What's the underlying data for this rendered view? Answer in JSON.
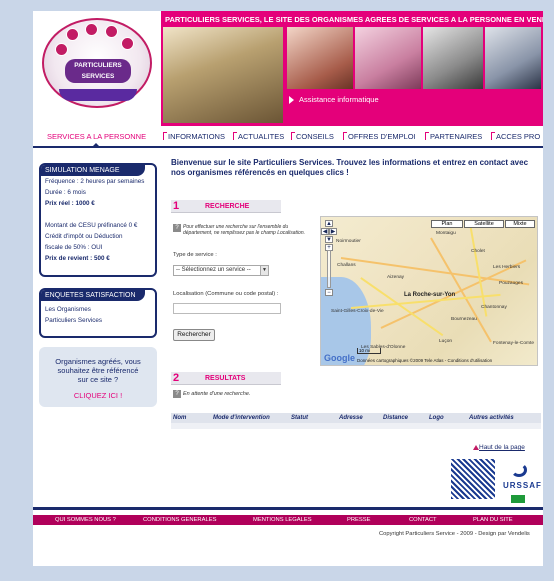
{
  "header": {
    "logo_text_line1": "PARTICULIERS",
    "logo_text_line2": "SERVICES",
    "slogan": "PARTICULIERS SERVICES, LE SITE DES ORGANISMES AGREES DE SERVICES A LA PERSONNE EN VENDEE",
    "banner_caption": "Assistance informatique"
  },
  "nav": {
    "items": [
      "SERVICES A LA PERSONNE",
      "INFORMATIONS",
      "ACTUALITES",
      "CONSEILS",
      "OFFRES D'EMPLOI",
      "PARTENAIRES",
      "ACCES PRO"
    ],
    "active_index": 0
  },
  "sidebar": {
    "simulation": {
      "title": "SIMULATION MENAGE",
      "lines": [
        "Fréquence : 2 heures par semaines",
        "Durée : 6 mois",
        "Prix réel : 1000 €",
        "",
        "Montant de CESU préfinancé 0 €",
        "Crédit d'impôt ou Déduction",
        "fiscale de 50% : OUI",
        "Prix de revient : 500 €"
      ]
    },
    "enquetes": {
      "title": "ENQUETES SATISFACTION",
      "items": [
        "Les Organismes",
        "Particuliers Services"
      ]
    },
    "promo": {
      "text_line1": "Organismes agréés, vous",
      "text_line2": "souhaitez être référencé",
      "text_line3": "sur ce site ?",
      "link": "CLIQUEZ ICI !"
    }
  },
  "main": {
    "welcome": "Bienvenue sur le site Particuliers Services. Trouvez les informations et entrez en contact avec nos organismes référencés en quelques clics !",
    "search": {
      "number": "1",
      "title": "RECHERCHE",
      "help_line1": "Pour effectuer une recherche sur l'ensemble du",
      "help_line2": "département, ne remplissez pas le champ Localisation.",
      "service_label": "Type de service :",
      "service_value": "-- Sélectionnez un service --",
      "location_label": "Localisation (Commune ou code postal) :",
      "location_value": "",
      "button": "Rechercher"
    },
    "results": {
      "number": "2",
      "title": "RESULTATS",
      "waiting": "En attente d'une recherche.",
      "columns": [
        "Nom",
        "Mode d'intervention",
        "Statut",
        "Adresse",
        "Distance",
        "Logo",
        "Autres activités"
      ]
    },
    "map": {
      "buttons": [
        "Plan",
        "Satellite",
        "Mixte"
      ],
      "cities": [
        "Cholet",
        "Les Herbiers",
        "Chantonnay",
        "La Roche-sur-Yon",
        "Aizenay",
        "Challans",
        "Saint-Gilles-Croix-de-Vie",
        "Les Sables-d'Olonne",
        "Luçon",
        "Fontenay-le-Comte",
        "Montaigu",
        "Noirmoutier",
        "Pouzauges",
        "Bournezeau"
      ],
      "copyright": "Données cartographiques ©2009 Tele Atlas - Conditions d'utilisation",
      "brand": "Google",
      "scale": "10 mi"
    }
  },
  "top_link": "Haut de la page",
  "partner": {
    "name": "URSSAF"
  },
  "footer": {
    "items": [
      "QUI SOMMES NOUS ?",
      "CONDITIONS GENERALES",
      "MENTIONS LEGALES",
      "PRESSE",
      "CONTACT",
      "PLAN DU SITE"
    ],
    "copyright": "Copyright Particuliers Service - 2009 - Design par Vendelis"
  },
  "colors": {
    "brand_pink": "#e4007a",
    "navy": "#1a2a6c",
    "page_background": "#c9d6e8",
    "footer_bar": "#b0005a"
  }
}
